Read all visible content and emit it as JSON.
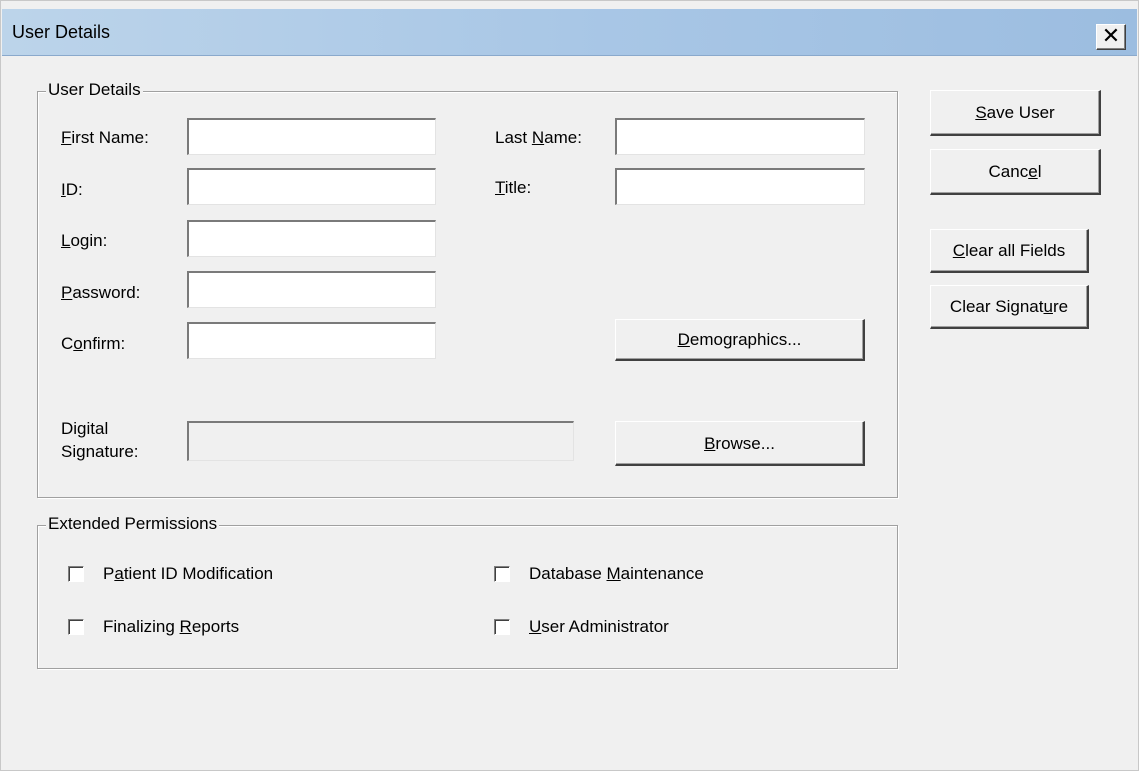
{
  "window": {
    "title": "User Details",
    "close_glyph": "✕"
  },
  "user_details_group": {
    "legend": "User Details",
    "first_name": {
      "label_pre": "",
      "label_ul": "F",
      "label_post": "irst Name:",
      "value": ""
    },
    "last_name": {
      "label_pre": "Last ",
      "label_ul": "N",
      "label_post": "ame:",
      "value": ""
    },
    "id": {
      "label_pre": "",
      "label_ul": "I",
      "label_post": "D:",
      "value": ""
    },
    "title": {
      "label_pre": "",
      "label_ul": "T",
      "label_post": "itle:",
      "value": ""
    },
    "login": {
      "label_pre": "",
      "label_ul": "L",
      "label_post": "ogin:",
      "value": ""
    },
    "password": {
      "label_pre": "",
      "label_ul": "P",
      "label_post": "assword:",
      "value": ""
    },
    "confirm": {
      "label_pre": "C",
      "label_ul": "o",
      "label_post": "nfirm:",
      "value": ""
    },
    "demographics_button": {
      "label_pre": "",
      "label_ul": "D",
      "label_post": "emographics..."
    },
    "digital_signature": {
      "label_line1": "Digital",
      "label_line2": "Signature:",
      "value": ""
    },
    "browse_button": {
      "label_pre": "",
      "label_ul": "B",
      "label_post": "rowse..."
    }
  },
  "extended_permissions_group": {
    "legend": "Extended Permissions",
    "patient_id_modification": {
      "label_pre": "P",
      "label_ul": "a",
      "label_post": "tient ID Modification",
      "checked": false
    },
    "finalizing_reports": {
      "label_pre": "Finalizing ",
      "label_ul": "R",
      "label_post": "eports",
      "checked": false
    },
    "database_maintenance": {
      "label_pre": "Database ",
      "label_ul": "M",
      "label_post": "aintenance",
      "checked": false
    },
    "user_administrator": {
      "label_pre": "",
      "label_ul": "U",
      "label_post": "ser Administrator",
      "checked": false
    }
  },
  "side_buttons": {
    "save_user": {
      "label_pre": "",
      "label_ul": "S",
      "label_post": "ave User"
    },
    "cancel": {
      "label_pre": "Canc",
      "label_ul": "e",
      "label_post": "l"
    },
    "clear_all_fields": {
      "label_pre": "",
      "label_ul": "C",
      "label_post": "lear all Fields"
    },
    "clear_signature": {
      "label_pre": "Clear Signat",
      "label_ul": "u",
      "label_post": "re"
    }
  }
}
